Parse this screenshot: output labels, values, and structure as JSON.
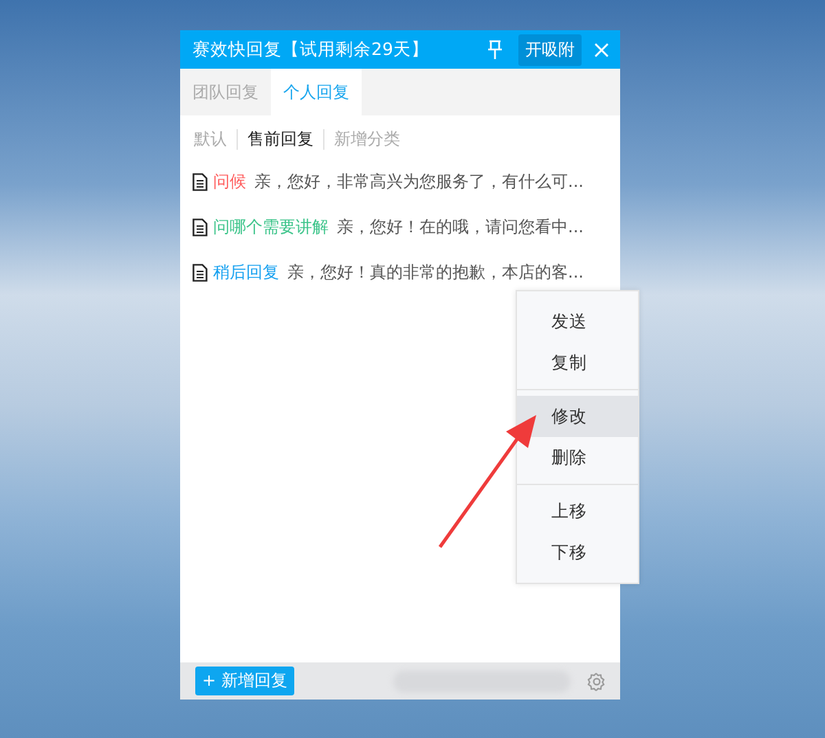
{
  "window": {
    "title": "赛效快回复【试用剩余29天】",
    "pin_button": "开吸附"
  },
  "tabs": [
    {
      "label": "团队回复",
      "selected": false
    },
    {
      "label": "个人回复",
      "selected": true
    }
  ],
  "categories": [
    {
      "label": "默认",
      "selected": false
    },
    {
      "label": "售前回复",
      "selected": true
    },
    {
      "label": "新增分类",
      "selected": false
    }
  ],
  "replies": [
    {
      "title": "问候",
      "color": "#ff5b5b",
      "text": "亲，您好，非常高兴为您服务了，有什么可..."
    },
    {
      "title": "问哪个需要讲解",
      "color": "#3cc48a",
      "text": "亲，您好！在的哦，请问您看中..."
    },
    {
      "title": "稍后回复",
      "color": "#14a0f0",
      "text": "亲，您好！真的非常的抱歉，本店的客..."
    }
  ],
  "context_menu": {
    "groups": [
      [
        {
          "label": "发送",
          "selected": false
        },
        {
          "label": "复制",
          "selected": false
        }
      ],
      [
        {
          "label": "修改",
          "selected": true
        },
        {
          "label": "删除",
          "selected": false
        }
      ],
      [
        {
          "label": "上移",
          "selected": false
        },
        {
          "label": "下移",
          "selected": false
        }
      ]
    ]
  },
  "footer": {
    "add_button": "+ 新增回复"
  }
}
